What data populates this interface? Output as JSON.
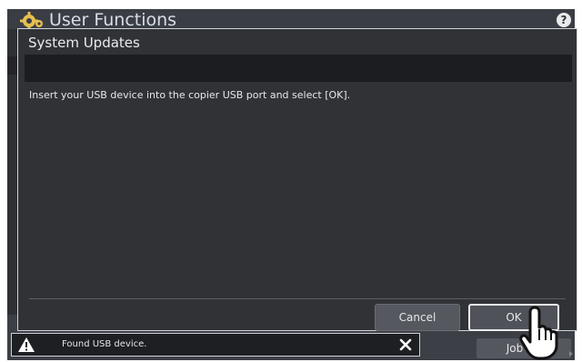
{
  "app": {
    "title": "User Functions",
    "help_label": "?"
  },
  "background": {
    "job_button_label": "Job"
  },
  "dialog": {
    "title": "System Updates",
    "message": "Insert your USB device into the copier USB port and select [OK].",
    "cancel_label": "Cancel",
    "ok_label": "OK"
  },
  "notification": {
    "text": "Found USB device."
  },
  "icons": {
    "app": "gear-icon",
    "help": "help-icon",
    "warning": "warning-icon",
    "close": "close-icon",
    "cursor": "hand-cursor-icon"
  },
  "colors": {
    "background": "#2e3034",
    "dialog_border": "#cfd3da",
    "dialog_bar": "#1c1d21",
    "text": "#e6e8ec",
    "button": "#55585e"
  }
}
